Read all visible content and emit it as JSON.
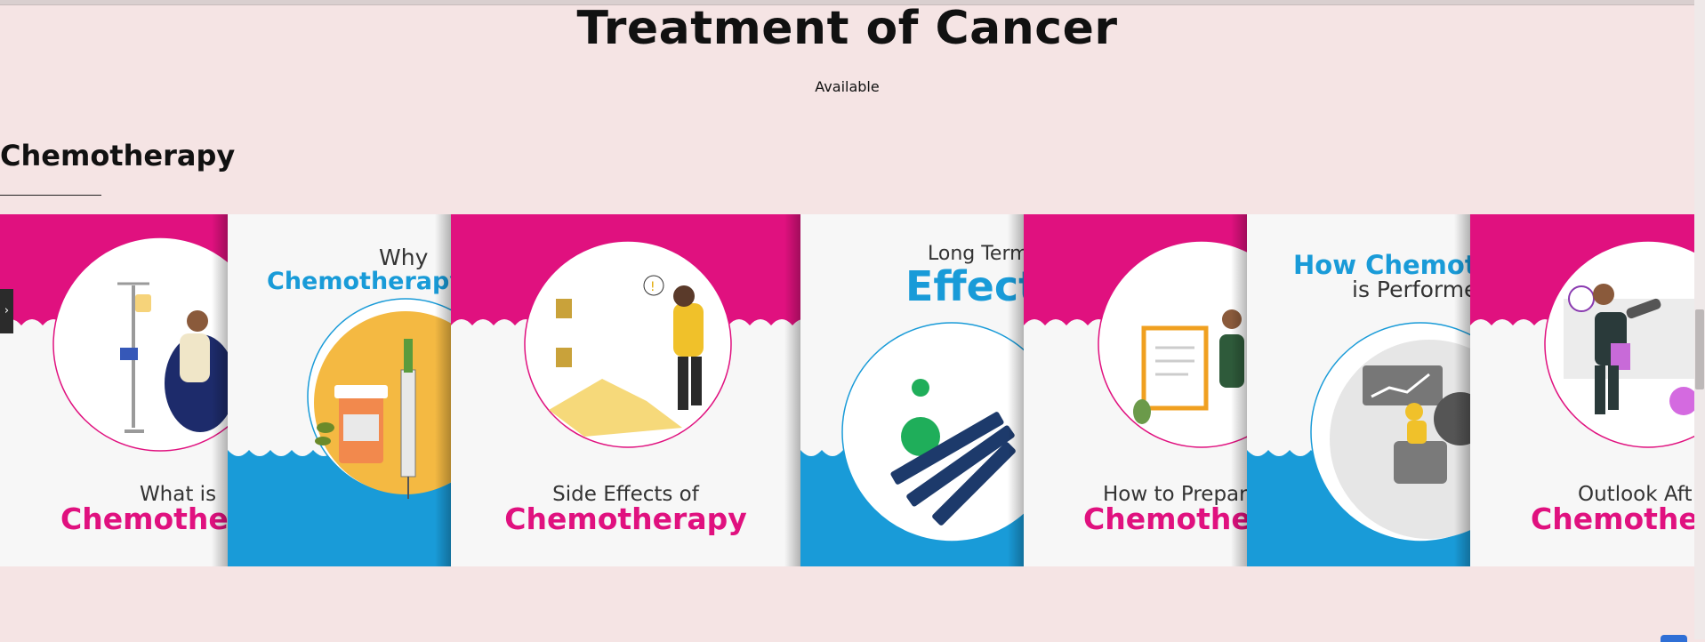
{
  "page": {
    "title": "Treatment of Cancer",
    "subtitle": "Available"
  },
  "section": {
    "title": "Chemotherapy"
  },
  "carousel": {
    "prev_glyph": "›",
    "cards": [
      {
        "line1": "What is",
        "line2": "Chemothera",
        "style": "pink"
      },
      {
        "line1": "Why",
        "line2": "Chemotherapy i",
        "style": "blue"
      },
      {
        "line1": "Side Effects of",
        "line2": "Chemotherapy",
        "style": "pink"
      },
      {
        "line1": "Long Term",
        "line2": "Effect",
        "style": "blue"
      },
      {
        "line1": "How to Prepar",
        "line2": "Chemothera",
        "style": "pink"
      },
      {
        "line1": "How Chemoth",
        "line2": "is Performe",
        "style": "blue"
      },
      {
        "line1": "Outlook Aft",
        "line2": "Chemother",
        "style": "pink"
      }
    ]
  },
  "colors": {
    "background": "#f5e4e4",
    "magenta": "#e0117f",
    "blue": "#199bd8",
    "text": "#111111"
  }
}
